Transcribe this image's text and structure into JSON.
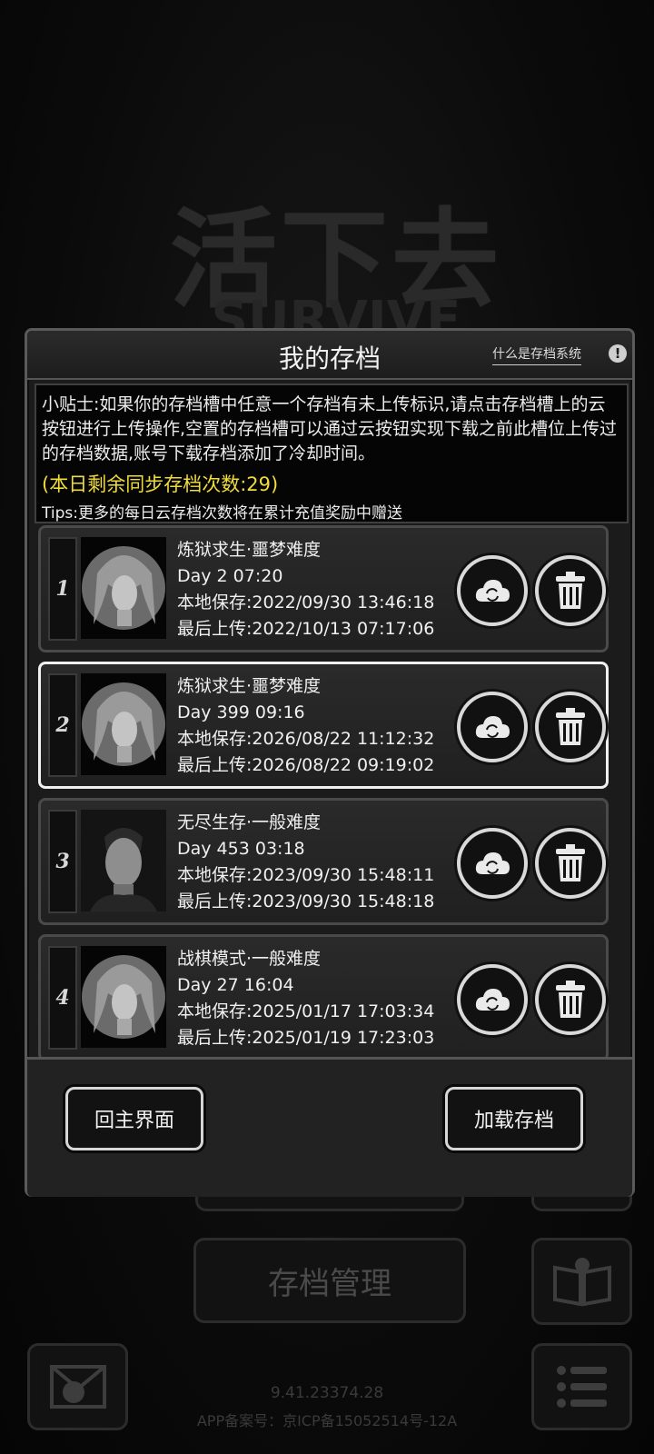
{
  "background": {
    "logo": "活下去",
    "logo_sub": "SURVIVE",
    "manage_button": "存档管理",
    "version": "9.41.23374.28",
    "icp": "APP备案号：京ICP备15052514号-12A"
  },
  "dialog": {
    "title": "我的存档",
    "help_link": "什么是存档系统",
    "help_icon": "!",
    "tips": {
      "text": "小贴士:如果你的存档槽中任意一个存档有未上传标识,请点击存档槽上的云按钮进行上传操作,空置的存档槽可以通过云按钮实现下载之前此槽位上传过的存档数据,账号下载存档添加了冷却时间。",
      "sync_count": "(本日剩余同步存档次数:29)",
      "bottom": "Tips:更多的每日云存档次数将在累计充值奖励中赠送"
    },
    "slots": [
      {
        "num": "1",
        "mode": "炼狱求生·噩梦难度",
        "day": "Day 2  07:20",
        "local": "本地保存:2022/09/30  13:46:18",
        "upload": "最后上传:2022/10/13  07:17:06",
        "portrait": "female-survivor"
      },
      {
        "num": "2",
        "mode": "炼狱求生·噩梦难度",
        "day": "Day 399  09:16",
        "local": "本地保存:2026/08/22  11:12:32",
        "upload": "最后上传:2026/08/22  09:19:02",
        "portrait": "female-survivor"
      },
      {
        "num": "3",
        "mode": "无尽生存·一般难度",
        "day": "Day 453  03:18",
        "local": "本地保存:2023/09/30  15:48:11",
        "upload": "最后上传:2023/09/30  15:48:18",
        "portrait": "male-survivor"
      },
      {
        "num": "4",
        "mode": "战棋模式·一般难度",
        "day": "Day 27  16:04",
        "local": "本地保存:2025/01/17  17:03:34",
        "upload": "最后上传:2025/01/19  17:23:03",
        "portrait": "female-survivor"
      }
    ],
    "footer": {
      "home_button": "回主界面",
      "load_button": "加载存档"
    }
  },
  "icons": [
    "cloud-sync-icon",
    "trash-icon",
    "help-icon",
    "book-icon",
    "menu-icon",
    "share-icon"
  ]
}
